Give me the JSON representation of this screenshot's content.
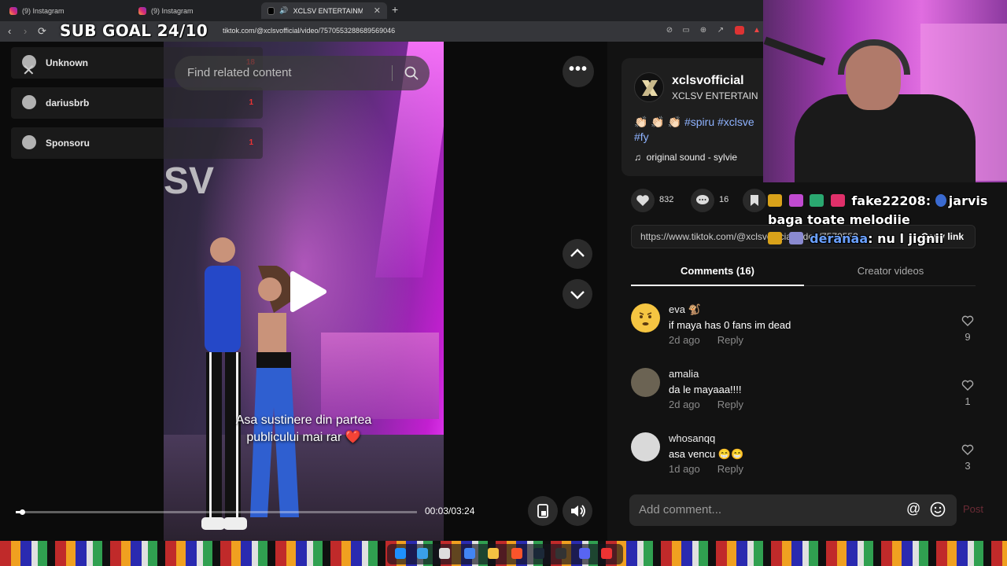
{
  "browser": {
    "tabs": [
      {
        "title": "(9) Instagram",
        "type": "instagram"
      },
      {
        "title": "(9) Instagram",
        "type": "instagram"
      },
      {
        "title": "XCLSV ENTERTAINMENT (@xcl",
        "type": "tiktok",
        "active": true
      }
    ],
    "url": "tiktok.com/@xclsvofficial/video/7570553288689569046"
  },
  "stream_overlay": {
    "sub_goal": "SUB GOAL 24/10",
    "alerts": [
      {
        "name": "Unknown",
        "count": "18"
      },
      {
        "name": "dariusbrb",
        "count": "1"
      },
      {
        "name": "Sponsoru",
        "count": "1"
      }
    ],
    "chat": [
      {
        "user": "fake22208",
        "sep": ":",
        "mention": "jarvis",
        "message": ""
      },
      {
        "user": "",
        "sep": "",
        "mention": "",
        "message": "baga toate melodiie"
      },
      {
        "user": "deranaa",
        "sep": ":",
        "mention": "",
        "message": "nu l jignii"
      }
    ]
  },
  "search": {
    "placeholder": "Find related content"
  },
  "video": {
    "caption_line1": "Asa sustinere din partea",
    "caption_line2": "publicului mai rar",
    "caption_emoji": "❤️",
    "time": "00:03/03:24",
    "progress": 0.015
  },
  "post": {
    "username": "xclsvofficial",
    "nickname": "XCLSV ENTERTAIN",
    "desc_claps": "👏🏻 👏🏻 👏🏻",
    "desc_tags": "#spiru #xclsve",
    "desc_tag2": "#fy",
    "music_icon": "♫",
    "music": "original sound - sylvie",
    "likes": "832",
    "comments": "16",
    "link": "https://www.tiktok.com/@xclsvofficial/video/7570553...",
    "copy_label": "Copy link"
  },
  "panel_tabs": {
    "comments": "Comments (16)",
    "creator": "Creator videos"
  },
  "comments": [
    {
      "name": "eva 🐒",
      "text": "if maya has 0 fans im dead",
      "time": "2d ago",
      "reply": "Reply",
      "likes": "9"
    },
    {
      "name": "amalia",
      "text": "da le mayaaa!!!!",
      "time": "2d ago",
      "reply": "Reply",
      "likes": "1"
    },
    {
      "name": "whosanqq",
      "text": "asa vencu 😁😁",
      "time": "1d ago",
      "reply": "Reply",
      "likes": "3"
    }
  ],
  "composer": {
    "placeholder": "Add comment...",
    "at": "@",
    "post_label": "Post"
  },
  "colors": {
    "accent_post": "#6b2b35",
    "tag_blue": "#8fb3ff",
    "chat_blue": "#6aa0ff"
  }
}
